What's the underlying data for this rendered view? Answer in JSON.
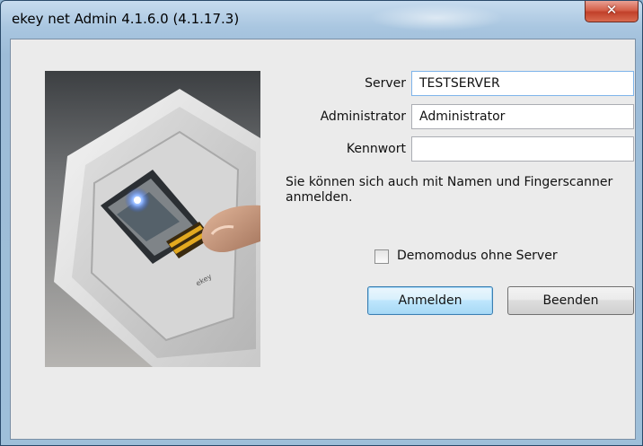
{
  "window": {
    "title": "ekey net Admin 4.1.6.0 (4.1.17.3)",
    "close_glyph": "✕"
  },
  "login": {
    "server_label": "Server",
    "server_value": "TESTSERVER",
    "admin_label": "Administrator",
    "admin_value": "Administrator",
    "password_label": "Kennwort",
    "password_value": "",
    "hint": "Sie können sich auch mit Namen und Fingerscanner anmelden.",
    "demo_label": "Demomodus ohne Server",
    "demo_checked": false,
    "login_button": "Anmelden",
    "exit_button": "Beenden"
  },
  "image": {
    "icon": "fingerprint-scanner-photo",
    "device_text": "ekey"
  }
}
